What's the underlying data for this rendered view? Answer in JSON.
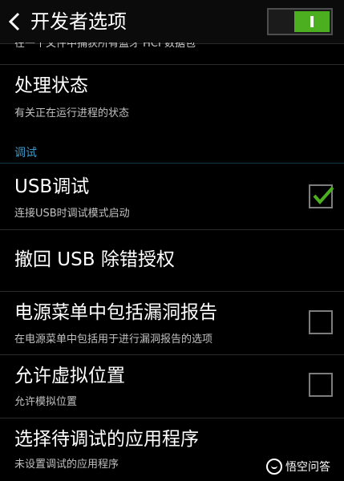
{
  "header": {
    "title": "开发者选项",
    "master_switch_on": true
  },
  "partial_top_text": "在一个文件中捕获所有蓝牙 HCI 数据包",
  "rows": [
    {
      "title": "处理状态",
      "subtitle": "有关正在运行进程的状态"
    },
    {
      "title": "USB调试",
      "subtitle": "连接USB时调试模式启动",
      "checked": true
    },
    {
      "title": "撤回 USB 除错授权"
    },
    {
      "title": "电源菜单中包括漏洞报告",
      "subtitle": "在电源菜单中包括用于进行漏洞报告的选项",
      "checked": false
    },
    {
      "title": "允许虚拟位置",
      "subtitle": "允许模拟位置",
      "checked": false
    },
    {
      "title": "选择待调试的应用程序",
      "subtitle": "未设置调试的应用程序"
    }
  ],
  "section_label": "调试",
  "watermark": "悟空问答",
  "colors": {
    "accent_green": "#4caf1f",
    "section_blue": "#3a9acb",
    "background": "#000000"
  },
  "icons": [
    "back-arrow-icon",
    "checkmark-icon",
    "wukong-logo-icon"
  ]
}
